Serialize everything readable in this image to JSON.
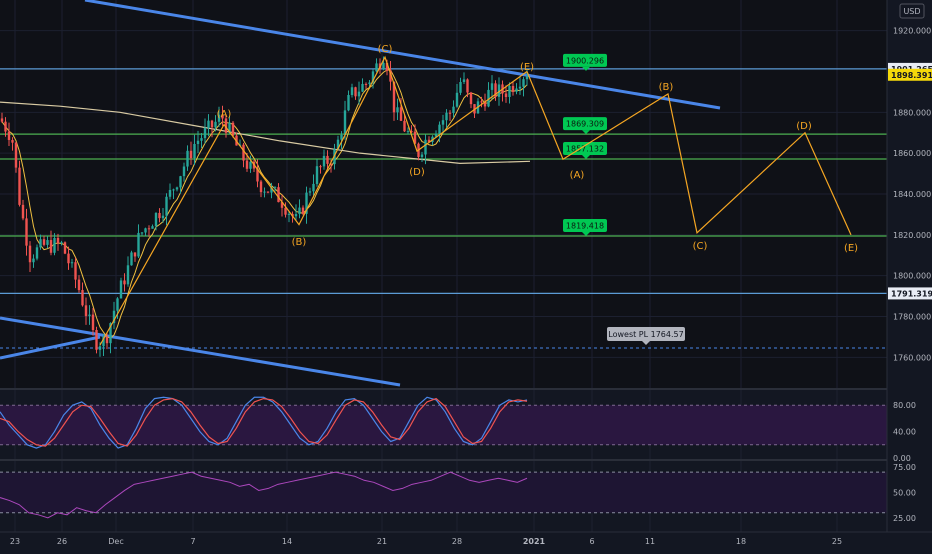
{
  "header": {
    "currency": "USD"
  },
  "wave_labels": {
    "A": "(A)",
    "B": "(B)",
    "C": "(C)",
    "D": "(D)",
    "E": "(E)"
  },
  "chart_data": [
    {
      "type": "line",
      "panel": "price",
      "ylim": [
        1745,
        1935
      ],
      "y_ticks": [
        "1920.000",
        "1880.000",
        "1860.000",
        "1840.000",
        "1820.000",
        "1800.000",
        "1780.000",
        "1760.000"
      ],
      "x_tick_labels": [
        "23",
        "26",
        "Dec",
        "7",
        "14",
        "21",
        "28",
        "2021",
        "6",
        "11",
        "18",
        "25"
      ],
      "price_badges": [
        {
          "label": "1901.265",
          "value": 1901.265,
          "kind": "level"
        },
        {
          "label": "1898.391",
          "value": 1898.391,
          "kind": "last"
        },
        {
          "label": "1791.319",
          "value": 1791.319,
          "kind": "level"
        }
      ],
      "horizontal_levels": [
        {
          "value": 1901.265,
          "color": "#5b9bd5"
        },
        {
          "value": 1869.309,
          "color": "#4caf50"
        },
        {
          "value": 1857.132,
          "color": "#4caf50"
        },
        {
          "value": 1819.418,
          "color": "#4caf50"
        },
        {
          "value": 1791.319,
          "color": "#5b9bd5"
        }
      ],
      "level_labels": [
        "1900.296",
        "1869.309",
        "1857.132",
        "1819.418"
      ],
      "lowest_label": "Lowest PL 1764.57",
      "lowest_value": 1764.57,
      "historical_waves": [
        "(A)",
        "(B)",
        "(C)",
        "(D)",
        "(E)"
      ],
      "projected_waves": [
        "(A)",
        "(B)",
        "(C)",
        "(D)",
        "(E)"
      ],
      "colors": {
        "up": "#26a69a",
        "down": "#ef5350",
        "wave": "#f5a623",
        "trend": "#4a86e8",
        "support": "#4caf50",
        "badge": "#00c853"
      }
    },
    {
      "type": "line",
      "panel": "stochastic",
      "ylim": [
        0,
        100
      ],
      "y_ticks": [
        "80.00",
        "40.00",
        "0.00"
      ],
      "bands": [
        80,
        20
      ],
      "series": [
        {
          "values": [
            70,
            50,
            35,
            20,
            15,
            20,
            40,
            65,
            80,
            85,
            75,
            50,
            30,
            15,
            20,
            45,
            75,
            90,
            92,
            90,
            80,
            60,
            40,
            25,
            20,
            30,
            55,
            80,
            92,
            92,
            85,
            70,
            50,
            30,
            20,
            25,
            45,
            70,
            88,
            90,
            80,
            60,
            40,
            25,
            30,
            55,
            80,
            92,
            88,
            70,
            45,
            25,
            20,
            30,
            55,
            80,
            88,
            85,
            88
          ]
        },
        {
          "values": [
            60,
            55,
            40,
            28,
            20,
            18,
            30,
            50,
            70,
            80,
            78,
            60,
            40,
            22,
            18,
            35,
            60,
            80,
            88,
            90,
            85,
            70,
            50,
            32,
            22,
            25,
            45,
            70,
            85,
            90,
            88,
            78,
            60,
            40,
            25,
            22,
            35,
            58,
            80,
            88,
            85,
            70,
            50,
            32,
            28,
            45,
            70,
            85,
            90,
            78,
            55,
            32,
            22,
            25,
            45,
            70,
            85,
            88,
            86
          ]
        }
      ]
    },
    {
      "type": "line",
      "panel": "rsi",
      "ylim": [
        15,
        80
      ],
      "y_ticks": [
        "75.00",
        "50.00",
        "25.00"
      ],
      "bands": [
        70,
        30
      ],
      "series": [
        {
          "values": [
            45,
            42,
            38,
            30,
            28,
            25,
            30,
            28,
            35,
            32,
            30,
            38,
            45,
            52,
            58,
            60,
            62,
            64,
            66,
            68,
            70,
            66,
            64,
            62,
            60,
            56,
            58,
            52,
            54,
            58,
            60,
            62,
            64,
            66,
            68,
            70,
            68,
            66,
            62,
            60,
            56,
            52,
            54,
            58,
            60,
            62,
            66,
            70,
            66,
            62,
            60,
            62,
            64,
            62,
            60,
            64
          ]
        }
      ]
    }
  ]
}
